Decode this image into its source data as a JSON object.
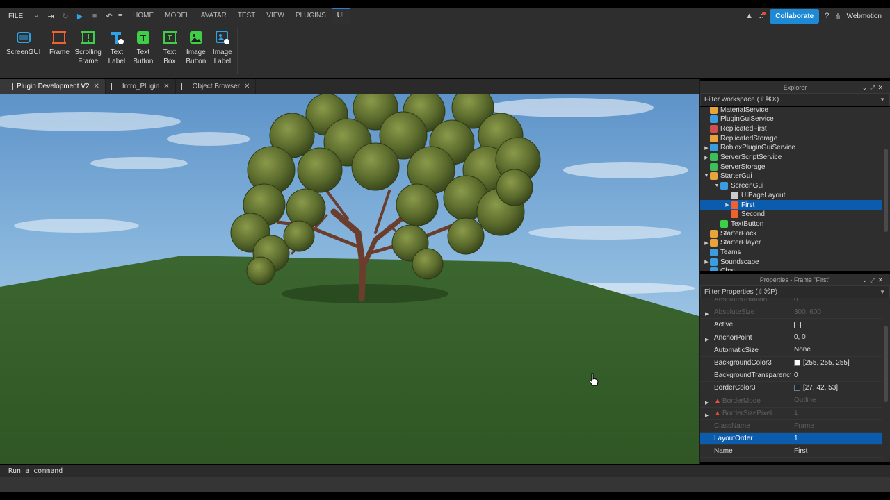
{
  "menubar": {
    "file": "FILE",
    "tabs": [
      "HOME",
      "MODEL",
      "AVATAR",
      "TEST",
      "VIEW",
      "PLUGINS",
      "UI"
    ],
    "active_tab": "UI",
    "collaborate": "Collaborate",
    "user": "Webmotion"
  },
  "ribbon": {
    "screengui": "ScreenGUI",
    "items": [
      {
        "label": "Frame",
        "icon": "frame-icon",
        "color": "#f0612d"
      },
      {
        "label": "Scrolling\nFrame",
        "icon": "scrolling-frame-icon",
        "color": "#3fcf47"
      },
      {
        "label": "Text\nLabel",
        "icon": "text-label-icon",
        "color": "#2fa3e8"
      },
      {
        "label": "Text\nButton",
        "icon": "text-button-icon",
        "color": "#3fcf47"
      },
      {
        "label": "Text\nBox",
        "icon": "text-box-icon",
        "color": "#3fcf47"
      },
      {
        "label": "Image\nButton",
        "icon": "image-button-icon",
        "color": "#3fcf47"
      },
      {
        "label": "Image\nLabel",
        "icon": "image-label-icon",
        "color": "#2fa3e8"
      }
    ]
  },
  "doctabs": [
    {
      "label": "Plugin Development V2",
      "active": true
    },
    {
      "label": "Intro_Plugin",
      "active": false
    },
    {
      "label": "Object Browser",
      "active": false
    }
  ],
  "explorer": {
    "title": "Explorer",
    "filter": "Filter workspace (⇧⌘X)",
    "rows": [
      {
        "label": "MaterialService",
        "indent": 0,
        "arrow": "",
        "color": "#e8a33a"
      },
      {
        "label": "PluginGuiService",
        "indent": 0,
        "arrow": "",
        "color": "#3b9de0"
      },
      {
        "label": "ReplicatedFirst",
        "indent": 0,
        "arrow": "",
        "color": "#d34e4e"
      },
      {
        "label": "ReplicatedStorage",
        "indent": 0,
        "arrow": "",
        "color": "#e8a33a"
      },
      {
        "label": "RobloxPluginGuiService",
        "indent": 0,
        "arrow": "▶",
        "color": "#3b9de0"
      },
      {
        "label": "ServerScriptService",
        "indent": 0,
        "arrow": "▶",
        "color": "#3fbf5a"
      },
      {
        "label": "ServerStorage",
        "indent": 0,
        "arrow": "",
        "color": "#3fbf5a"
      },
      {
        "label": "StarterGui",
        "indent": 0,
        "arrow": "▼",
        "color": "#e8a33a"
      },
      {
        "label": "ScreenGui",
        "indent": 1,
        "arrow": "▼",
        "color": "#3b9de0"
      },
      {
        "label": "UIPageLayout",
        "indent": 2,
        "arrow": "",
        "color": "#cccccc"
      },
      {
        "label": "First",
        "indent": 2,
        "arrow": "▶",
        "color": "#f0612d",
        "selected": true
      },
      {
        "label": "Second",
        "indent": 2,
        "arrow": "",
        "color": "#f0612d"
      },
      {
        "label": "TextButton",
        "indent": 1,
        "arrow": "",
        "color": "#3fcf47"
      },
      {
        "label": "StarterPack",
        "indent": 0,
        "arrow": "",
        "color": "#e8a33a"
      },
      {
        "label": "StarterPlayer",
        "indent": 0,
        "arrow": "▶",
        "color": "#e8a33a"
      },
      {
        "label": "Teams",
        "indent": 0,
        "arrow": "",
        "color": "#3b9de0"
      },
      {
        "label": "Soundscape",
        "indent": 0,
        "arrow": "▶",
        "color": "#3b9de0"
      },
      {
        "label": "Chat",
        "indent": 0,
        "arrow": "",
        "color": "#3b9de0"
      }
    ]
  },
  "properties": {
    "title": "Properties - Frame \"First\"",
    "filter": "Filter Properties (⇧⌘P)",
    "rows": [
      {
        "name": "AbsoluteRotation",
        "value": "0",
        "dim": true
      },
      {
        "name": "AbsoluteSize",
        "value": "300, 600",
        "dim": true,
        "arrow": true
      },
      {
        "name": "Active",
        "value": "",
        "checkbox": true
      },
      {
        "name": "AnchorPoint",
        "value": "0, 0",
        "arrow": true
      },
      {
        "name": "AutomaticSize",
        "value": "None"
      },
      {
        "name": "BackgroundColor3",
        "value": "[255, 255, 255]",
        "swatch": "#ffffff"
      },
      {
        "name": "BackgroundTransparency",
        "value": "0"
      },
      {
        "name": "BorderColor3",
        "value": "[27, 42, 53]",
        "swatch": "#1b2a35"
      },
      {
        "name": "BorderMode",
        "value": "Outline",
        "dim": true,
        "arrow": true,
        "warn": true
      },
      {
        "name": "BorderSizePixel",
        "value": "1",
        "dim": true,
        "arrow": true,
        "warn": true
      },
      {
        "name": "ClassName",
        "value": "Frame",
        "dim": true
      },
      {
        "name": "LayoutOrder",
        "value": "1",
        "selected": true
      },
      {
        "name": "Name",
        "value": "First"
      }
    ]
  },
  "command": {
    "placeholder": "Run a command"
  }
}
